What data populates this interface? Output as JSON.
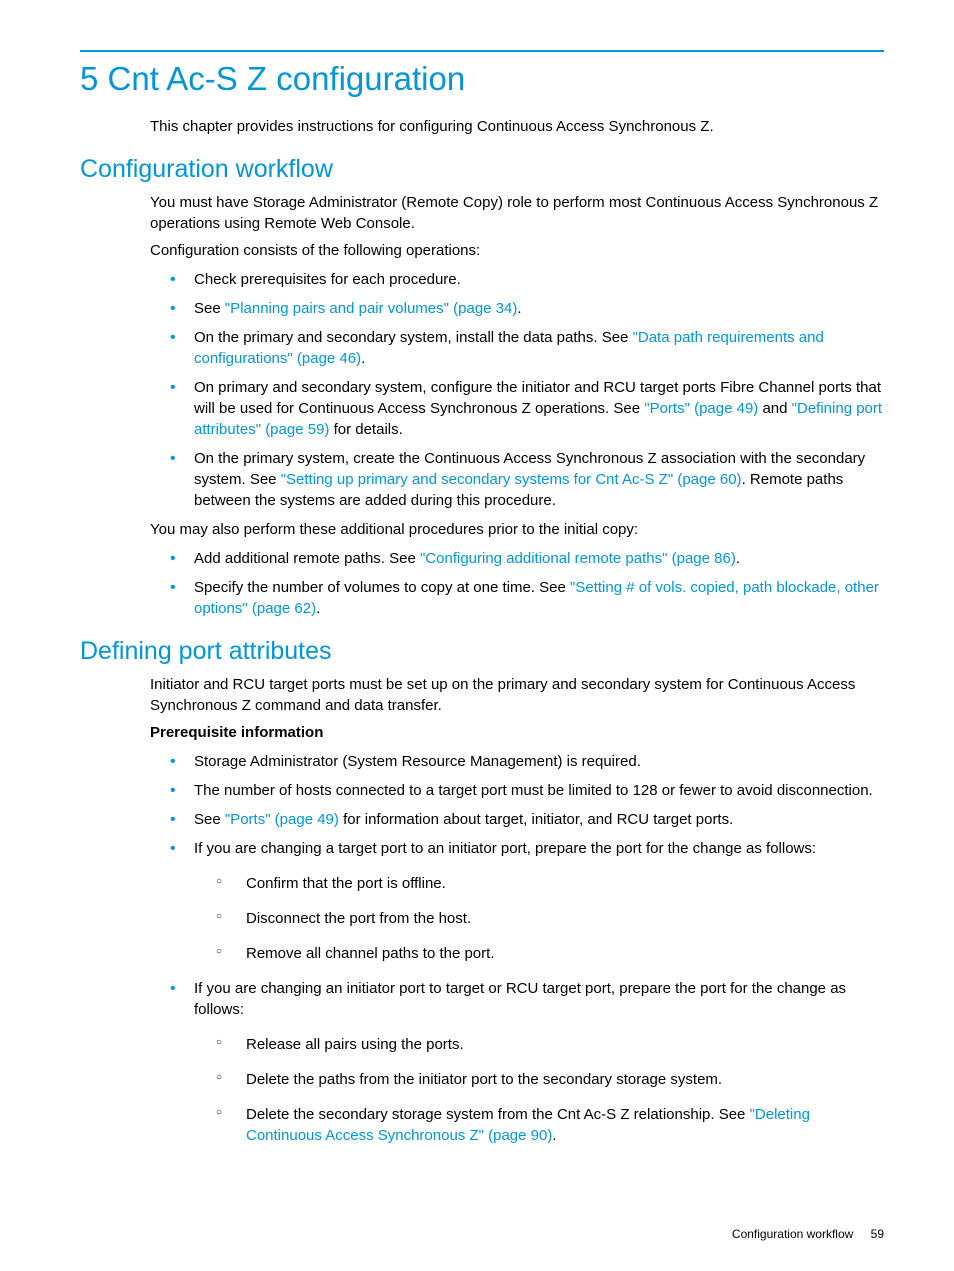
{
  "chapter_title": "5 Cnt Ac-S Z configuration",
  "intro": "This chapter provides instructions for configuring Continuous Access Synchronous Z.",
  "section1": {
    "heading": "Configuration workflow",
    "p1": "You must have Storage Administrator (Remote Copy) role to perform most Continuous Access Synchronous Z operations using Remote Web Console.",
    "p2": "Configuration consists of the following operations:",
    "b1": "Check prerequisites for each procedure.",
    "b2_pre": "See ",
    "b2_link": "\"Planning pairs and pair volumes\" (page 34)",
    "b2_post": ".",
    "b3_pre": "On the primary and secondary system, install the data paths. See ",
    "b3_link": "\"Data path requirements and configurations\" (page 46)",
    "b3_post": ".",
    "b4_pre": "On primary and secondary system, configure the initiator and RCU target ports Fibre Channel ports that will be used for Continuous Access Synchronous Z operations. See ",
    "b4_link1": "\"Ports\" (page 49)",
    "b4_mid": " and ",
    "b4_link2": "\"Defining port attributes\" (page 59)",
    "b4_post": " for details.",
    "b5_pre": "On the primary system, create the Continuous Access Synchronous Z association with the secondary system. See ",
    "b5_link": "\"Setting up primary and secondary systems for Cnt Ac-S Z\" (page 60)",
    "b5_post": ". Remote paths between the systems are added during this procedure.",
    "p3": "You may also perform these additional procedures prior to the initial copy:",
    "b6_pre": "Add additional remote paths. See ",
    "b6_link": "\"Configuring additional remote paths\" (page 86)",
    "b6_post": ".",
    "b7_pre": "Specify the number of volumes to copy at one time. See ",
    "b7_link": "\"Setting # of vols. copied, path blockade, other options\" (page 62)",
    "b7_post": "."
  },
  "section2": {
    "heading": "Defining port attributes",
    "p1": "Initiator and RCU target ports must be set up on the primary and secondary system for Continuous Access Synchronous Z command and data transfer.",
    "sub": "Prerequisite information",
    "b1": "Storage Administrator (System Resource Management) is required.",
    "b2": "The number of hosts connected to a target port must be limited to 128 or fewer to avoid disconnection.",
    "b3_pre": "See ",
    "b3_link": "\"Ports\" (page 49)",
    "b3_post": " for information about target, initiator, and RCU target ports.",
    "b4": "If you are changing a target port to an initiator port, prepare the port for the change as follows:",
    "b4_c1": "Confirm that the port is offline.",
    "b4_c2": "Disconnect the port from the host.",
    "b4_c3": "Remove all channel paths to the port.",
    "b5": "If you are changing an initiator port to target or RCU target port, prepare the port for the change as follows:",
    "b5_c1": "Release all pairs using the ports.",
    "b5_c2": "Delete the paths from the initiator port to the secondary storage system.",
    "b5_c3_pre": "Delete the secondary storage system from the Cnt Ac-S Z relationship. See ",
    "b5_c3_link": "\"Deleting Continuous Access Synchronous Z\" (page 90)",
    "b5_c3_post": "."
  },
  "footer": {
    "title": "Configuration workflow",
    "page": "59"
  }
}
